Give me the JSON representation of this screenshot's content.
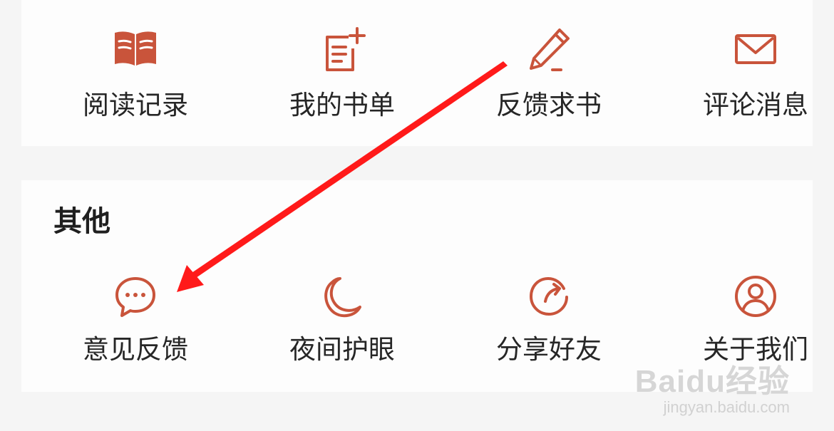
{
  "accent_color": "#c9543b",
  "top_grid": [
    {
      "label": "阅读记录",
      "icon": "open-book-icon"
    },
    {
      "label": "我的书单",
      "icon": "add-list-icon"
    },
    {
      "label": "反馈求书",
      "icon": "pencil-icon"
    },
    {
      "label": "评论消息",
      "icon": "mail-icon"
    }
  ],
  "other_section": {
    "title": "其他",
    "items": [
      {
        "label": "意见反馈",
        "icon": "chat-bubble-icon"
      },
      {
        "label": "夜间护眼",
        "icon": "moon-icon"
      },
      {
        "label": "分享好友",
        "icon": "share-icon"
      },
      {
        "label": "关于我们",
        "icon": "user-circle-icon"
      }
    ]
  },
  "annotation": {
    "arrow_color": "#ff1a1a"
  },
  "watermark": {
    "brand": "Baidu经验",
    "url": "jingyan.baidu.com"
  }
}
